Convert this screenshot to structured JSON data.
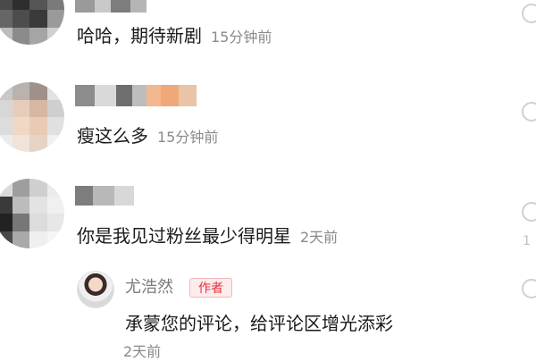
{
  "comments": [
    {
      "text": "哈哈，期待新剧",
      "time": "15分钟前"
    },
    {
      "text": "瘦这么多",
      "time": "15分钟前"
    },
    {
      "text": "你是我见过粉丝最少得明星",
      "time": "2天前"
    }
  ],
  "reply": {
    "author": "尤浩然",
    "badge": "作者",
    "text": "承蒙您的评论，给评论区增光添彩",
    "time": "2天前"
  },
  "side_counts": [
    "1",
    ""
  ],
  "colors": {
    "badge_text": "#e0333f",
    "badge_bg": "#fdecec",
    "timestamp": "#8a8a8a"
  },
  "icons": [
    "like-icon"
  ]
}
